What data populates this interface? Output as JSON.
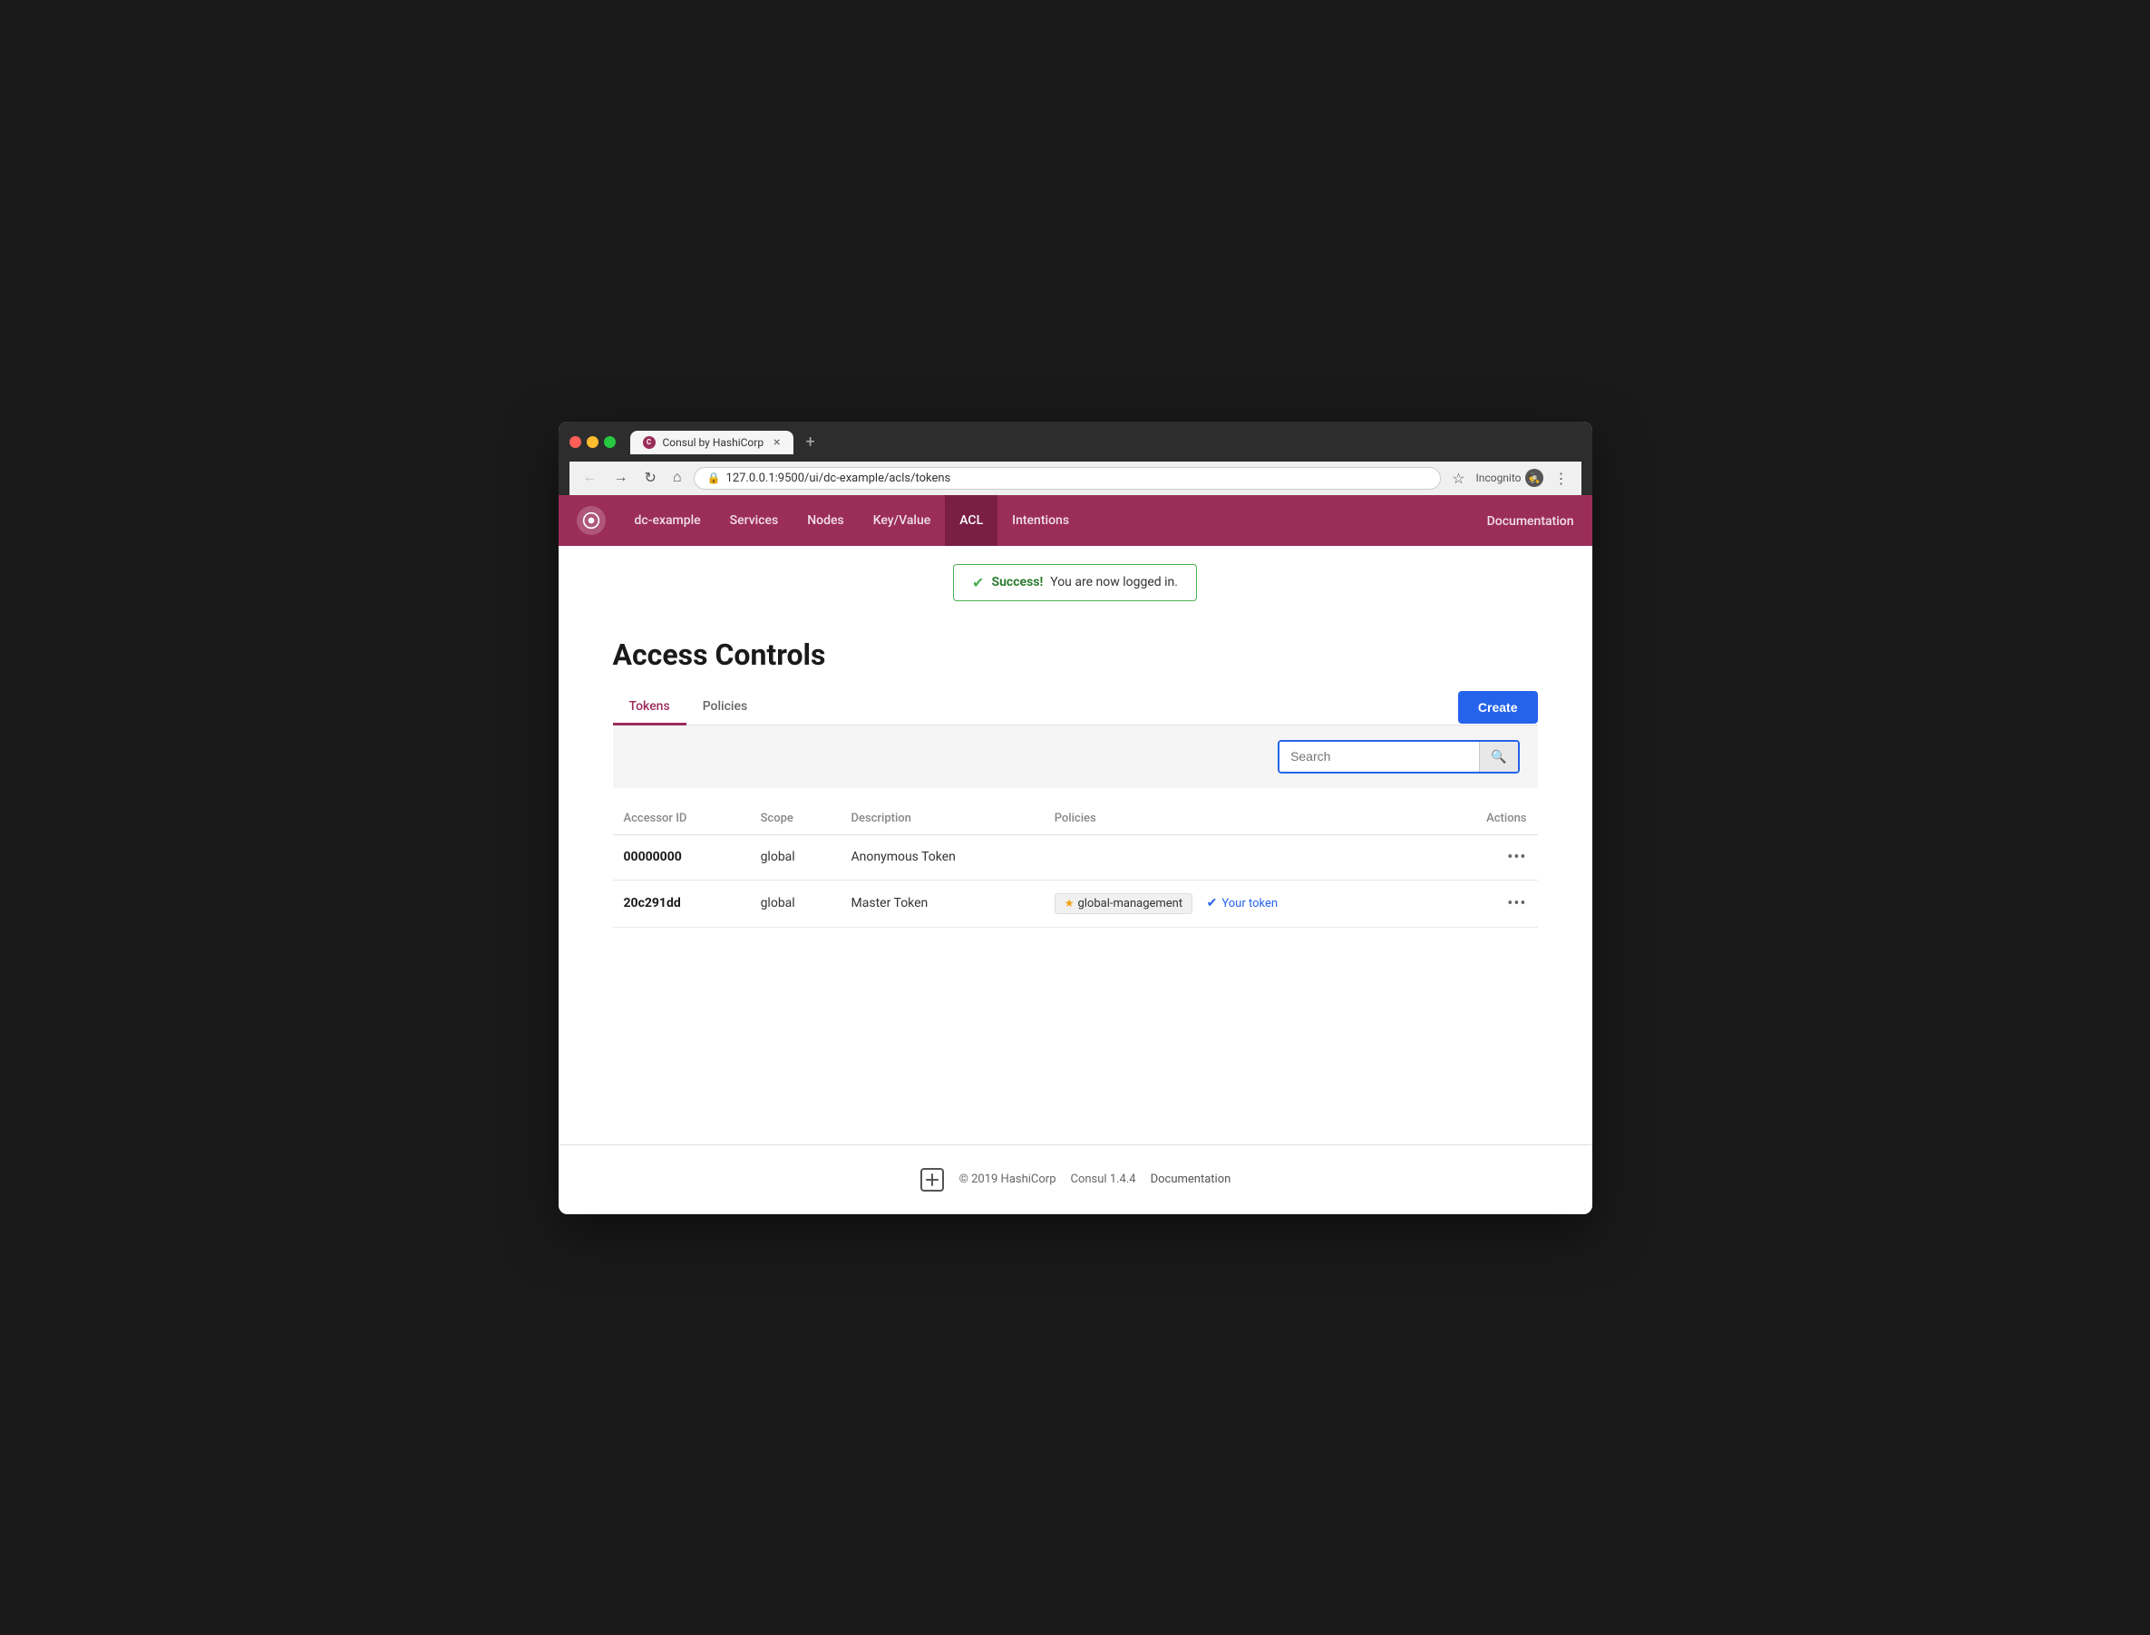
{
  "browser": {
    "tab_title": "Consul by HashiCorp",
    "tab_favicon": "C",
    "address": "127.0.0.1:9500/ui/dc-example/acls/tokens",
    "incognito_label": "Incognito"
  },
  "nav": {
    "logo_alt": "Consul",
    "datacenter": "dc-example",
    "links": [
      {
        "label": "dc-example",
        "active": false
      },
      {
        "label": "Services",
        "active": false
      },
      {
        "label": "Nodes",
        "active": false
      },
      {
        "label": "Key/Value",
        "active": false
      },
      {
        "label": "ACL",
        "active": true
      },
      {
        "label": "Intentions",
        "active": false
      }
    ],
    "doc_link": "Documentation"
  },
  "success_banner": {
    "label": "Success!",
    "message": " You are now logged in."
  },
  "page": {
    "title": "Access Controls"
  },
  "tabs": [
    {
      "label": "Tokens",
      "active": true
    },
    {
      "label": "Policies",
      "active": false
    }
  ],
  "create_button": "Create",
  "search": {
    "placeholder": "Search",
    "value": ""
  },
  "table": {
    "columns": [
      "Accessor ID",
      "Scope",
      "Description",
      "Policies",
      "Actions"
    ],
    "rows": [
      {
        "accessor_id": "00000000",
        "scope": "global",
        "description": "Anonymous Token",
        "policies": [],
        "your_token": false
      },
      {
        "accessor_id": "20c291dd",
        "scope": "global",
        "description": "Master Token",
        "policies": [
          "global-management"
        ],
        "your_token": true,
        "your_token_label": "Your token"
      }
    ]
  },
  "footer": {
    "copyright": "© 2019 HashiCorp",
    "version": "Consul 1.4.4",
    "doc_link": "Documentation"
  }
}
